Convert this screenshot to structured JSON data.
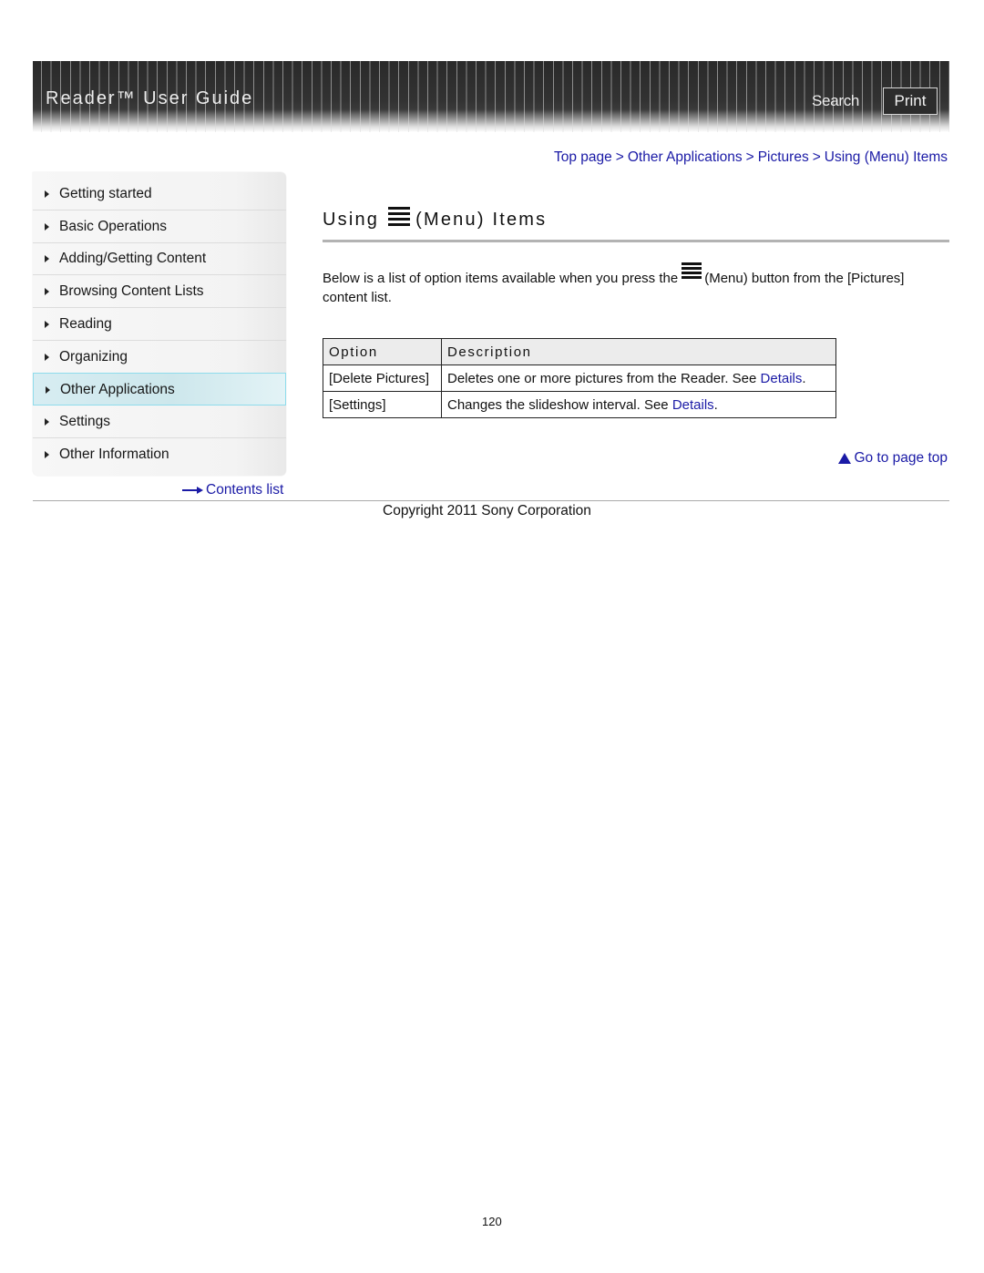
{
  "header": {
    "title": "Reader™ User Guide",
    "search_label": "Search",
    "print_label": "Print"
  },
  "sidebar": {
    "items": [
      {
        "label": "Getting started"
      },
      {
        "label": "Basic Operations"
      },
      {
        "label": "Adding/Getting Content"
      },
      {
        "label": "Browsing Content Lists"
      },
      {
        "label": "Reading"
      },
      {
        "label": "Organizing"
      },
      {
        "label": "Other Applications",
        "active": true
      },
      {
        "label": "Settings"
      },
      {
        "label": "Other Information"
      }
    ],
    "contents_link": "Contents list"
  },
  "breadcrumb": {
    "items": [
      "Top page",
      "Other Applications",
      "Pictures",
      "Using (Menu) Items"
    ],
    "separator": ">"
  },
  "main": {
    "title_prefix": "Using",
    "title_suffix": "(Menu) Items",
    "intro_part1": "Below is a list of option items available when you press the",
    "intro_part2": "(Menu) button from the [Pictures] content list.",
    "table": {
      "headers": [
        "Option",
        "Description"
      ],
      "rows": [
        {
          "option": "[Delete Pictures]",
          "description": "Deletes one or more pictures from the Reader. See ",
          "link": "Details",
          "tail": "."
        },
        {
          "option": "[Settings]",
          "description": "Changes the slideshow interval. See ",
          "link": "Details",
          "tail": "."
        }
      ]
    },
    "go_top": "Go to page top"
  },
  "footer": {
    "copyright": "Copyright 2011 Sony Corporation",
    "page_number": "120"
  },
  "colors": {
    "link": "#1a1aa6",
    "active_nav": "#cde7ec",
    "active_nav_border": "#8fdcec",
    "header_bg": "#2c2c2c"
  }
}
